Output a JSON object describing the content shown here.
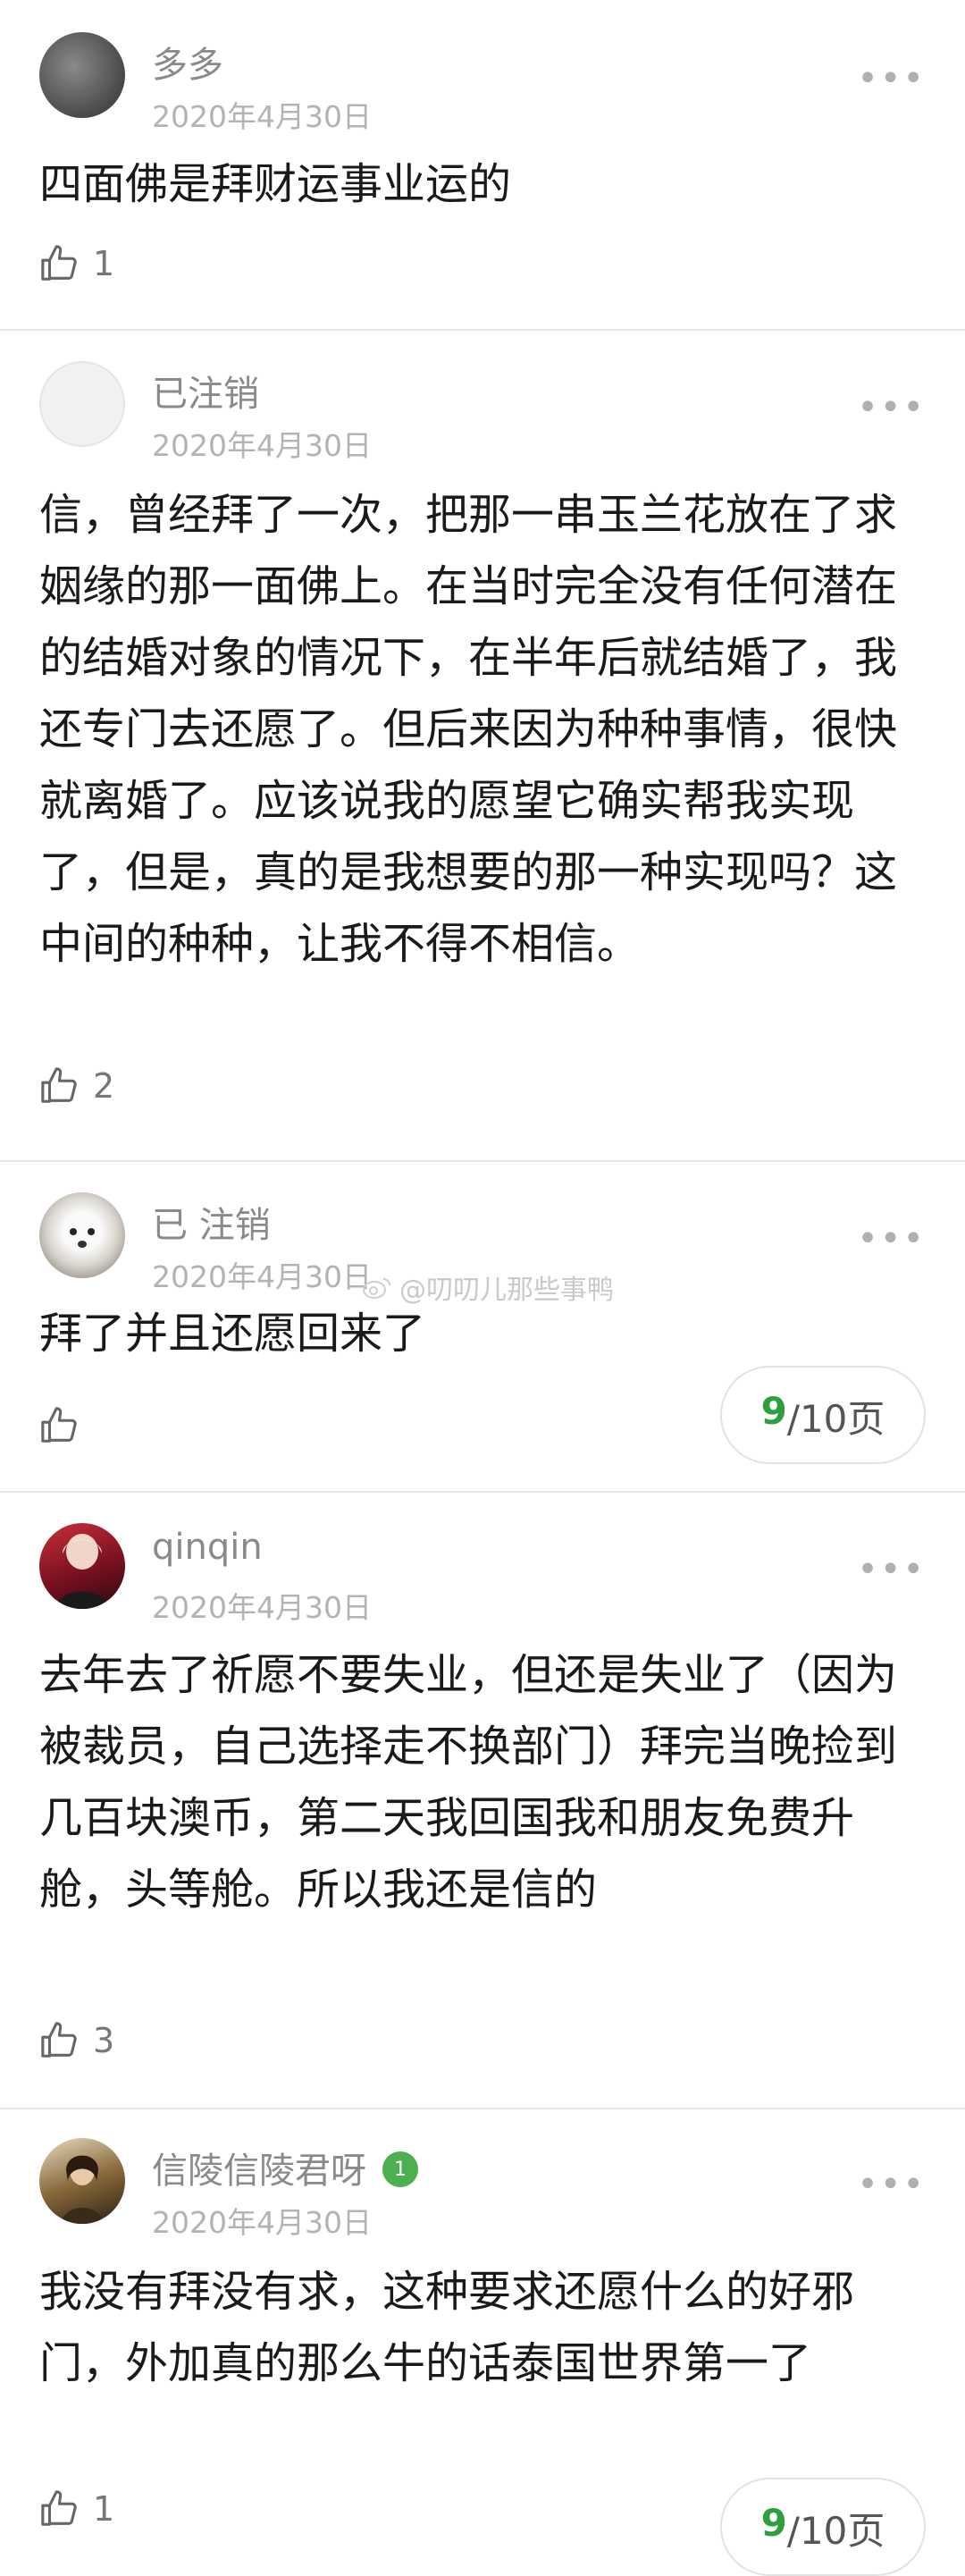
{
  "posts": [
    {
      "username": "多多",
      "date": "2020年4月30日",
      "text": "四面佛是拜财运事业运的",
      "likes": "1"
    },
    {
      "username": "已注销",
      "date": "2020年4月30日",
      "text": "信，曾经拜了一次，把那一串玉兰花放在了求姻缘的那一面佛上。在当时完全没有任何潜在的结婚对象的情况下，在半年后就结婚了，我还专门去还愿了。但后来因为种种事情，很快就离婚了。应该说我的愿望它确实帮我实现了，但是，真的是我想要的那一种实现吗？这中间的种种，让我不得不相信。",
      "likes": "2"
    },
    {
      "username": "已 注销",
      "date": "2020年4月30日",
      "text": "拜了并且还愿回来了",
      "likes": ""
    },
    {
      "username": "qinqin",
      "date": "2020年4月30日",
      "text": "去年去了祈愿不要失业，但还是失业了（因为被裁员，自己选择走不换部门）拜完当晚捡到几百块澳币，第二天我回国我和朋友免费升舱，头等舱。所以我还是信的",
      "likes": "3"
    },
    {
      "username": "信陵信陵君呀",
      "date": "2020年4月30日",
      "text": "我没有拜没有求，这种要求还愿什么的好邪门，外加真的那么牛的话泰国世界第一了",
      "likes": "1",
      "level": "1"
    }
  ],
  "pager": {
    "current": "9",
    "total": "/10页"
  },
  "watermark": "@叨叨儿那些事鸭",
  "icons": {
    "more": "more-dots-icon",
    "like": "thumbs-up-icon",
    "level": "level-badge-icon"
  },
  "colors": {
    "accent": "#2e9e3e",
    "badge": "#4caf50"
  }
}
